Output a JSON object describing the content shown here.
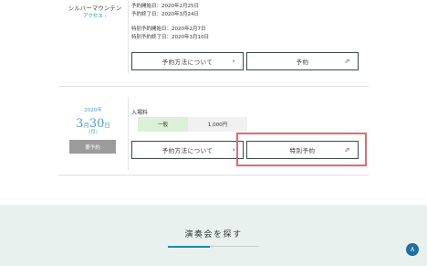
{
  "venue": {
    "name": "シルバーマウンテン",
    "access": "アクセス ›"
  },
  "event1": {
    "dates": [
      "予約開始日：2020年2月25日",
      "予約終了日：2020年3月24日",
      "特別予約開始日：2020年2月7日",
      "特別予約終了日：2020年3月10日"
    ],
    "buttons": {
      "how_to_label": "予約方法について",
      "how_to_icon": "›",
      "reserve_label": "予約",
      "reserve_icon": "⬀"
    }
  },
  "event2": {
    "year": "2020年",
    "month": "3",
    "month_unit": "月",
    "day": "30",
    "day_unit": "日",
    "weekday": "(月)",
    "status_badge": "要予約",
    "fee_label": "入場料",
    "fee": {
      "type": "一般",
      "price": "1,000円"
    },
    "buttons": {
      "how_to_label": "予約方法について",
      "how_to_icon": "›",
      "special_label": "特別予約",
      "special_icon": "⬀"
    }
  },
  "search": {
    "title": "演奏会を探す"
  },
  "scroll_top": {
    "icon": "∧"
  },
  "colors": {
    "accent_blue": "#4aa3c3",
    "highlight_red": "#e16a6e",
    "fee_green": "#dcefd7",
    "band_bg": "#e9f1ef",
    "badge_gray": "#9b9b9b"
  }
}
